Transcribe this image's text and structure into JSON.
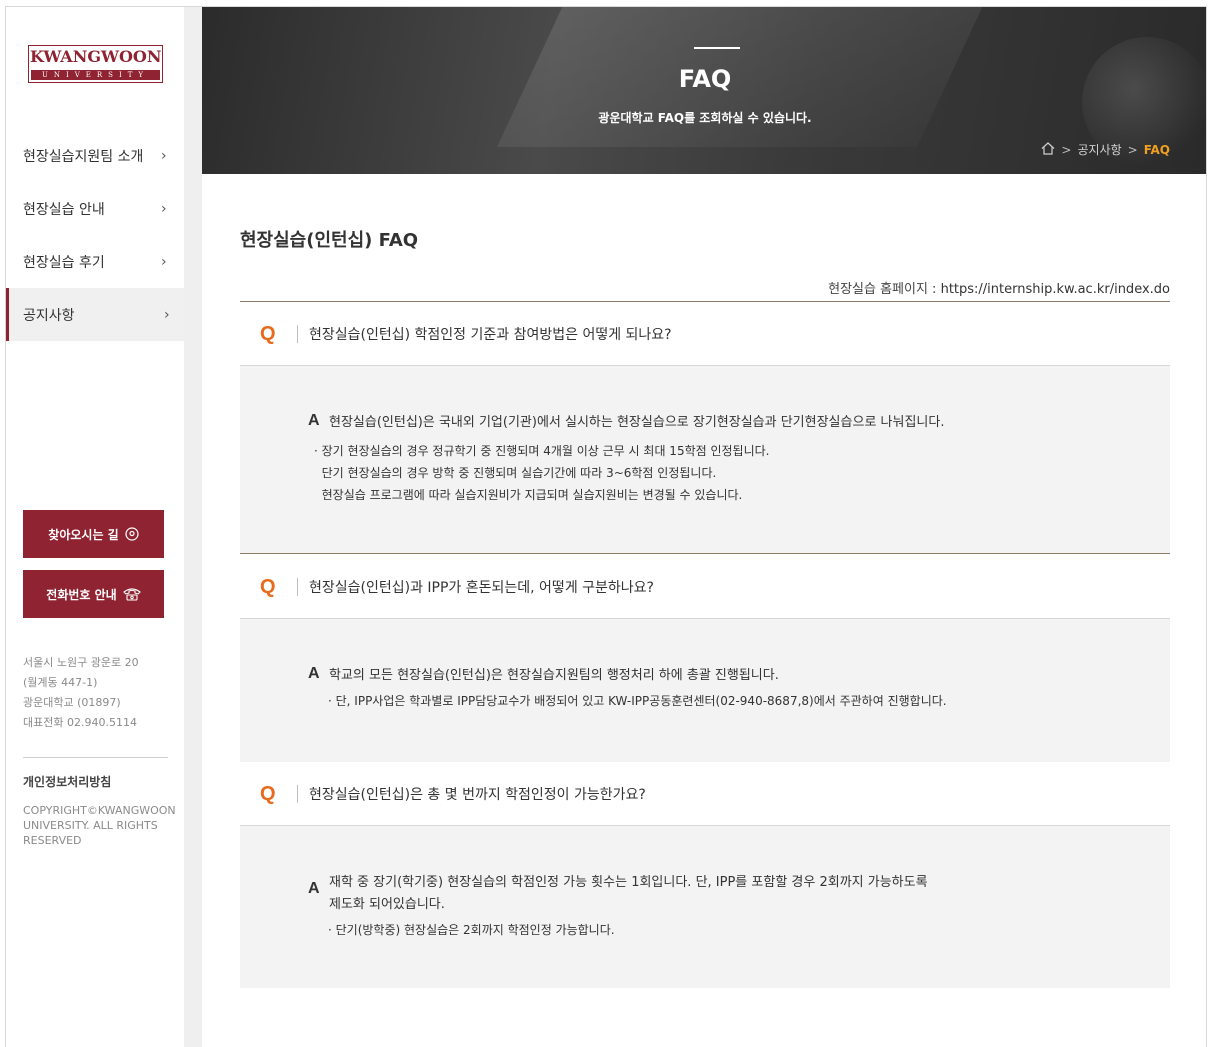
{
  "sidebar": {
    "logo": {
      "main": "KWANGWOON",
      "sub": "UNIVERSITY"
    },
    "nav": [
      {
        "label": "현장실습지원팀 소개",
        "chevron": "›"
      },
      {
        "label": "현장실습 안내",
        "chevron": "›"
      },
      {
        "label": "현장실습 후기",
        "chevron": "›"
      },
      {
        "label": "공지사항",
        "chevron": "›",
        "active": true
      }
    ],
    "buttons": {
      "directions": "찾아오시는 길",
      "phone": "전화번호 안내"
    },
    "address_lines": [
      "서울시 노원구 광운로 20",
      "(월계동 447-1)",
      "광운대학교 (01897)",
      "대표전화 02.940.5114"
    ],
    "privacy": "개인정보처리방침",
    "copyright": "COPYRIGHT©KWANGWOON UNIVERSITY. ALL RIGHTS RESERVED"
  },
  "banner": {
    "title": "FAQ",
    "subtitle": "광운대학교 FAQ를 조회하실 수 있습니다.",
    "breadcrumb": {
      "separator": ">",
      "section": "공지사항",
      "current": "FAQ"
    }
  },
  "main": {
    "title": "현장실습(인턴십) FAQ",
    "homepage_label": "현장실습 홈페이지 :",
    "homepage_url": "https://internship.kw.ac.kr/index.do",
    "faqs": [
      {
        "q_mark": "Q",
        "question": "현장실습(인턴십) 학점인정 기준과 참여방법은 어떻게 되나요?",
        "a_mark": "A",
        "answer": "현장실습(인턴십)은 국내외 기업(기관)에서 실시하는 현장실습으로 장기현장실습과 단기현장실습으로 나눠집니다.",
        "bullets": [
          "· 장기 현장실습의 경우 정규학기 중 진행되며 4개월 이상 근무 시 최대 15학점 인정됩니다.",
          "  단기 현장실습의 경우 방학 중 진행되며 실습기간에 따라 3~6학점 인정됩니다.",
          "  현장실습 프로그램에 따라 실습지원비가 지급되며 실습지원비는 변경될 수 있습니다."
        ]
      },
      {
        "q_mark": "Q",
        "question": "현장실습(인턴십)과 IPP가 혼돈되는데, 어떻게 구분하나요?",
        "a_mark": "A",
        "answer": "학교의 모든 현장실습(인턴십)은 현장실습지원팀의 행정처리 하에 총괄 진행됩니다.",
        "bullets": [
          "· 단, IPP사업은 학과별로 IPP담당교수가 배정되어 있고 KW-IPP공동훈련센터(02-940-8687,8)에서 주관하여 진행합니다."
        ]
      },
      {
        "q_mark": "Q",
        "question": "현장실습(인턴십)은 총 몇 번까지 학점인정이 가능한가요?",
        "a_mark": "A",
        "answer_lines": [
          "재학 중 장기(학기중) 현장실습의 학점인정 가능 횟수는 1회입니다. 단, IPP를 포함할 경우 2회까지 가능하도록",
          "제도화 되어있습니다."
        ],
        "bullets": [
          "· 단기(방학중) 현장실습은 2회까지 학점인정 가능합니다."
        ]
      }
    ]
  },
  "colors": {
    "brand": "#8f2332",
    "q_mark": "#e86a1c",
    "breadcrumb_current": "#f0a020",
    "answer_bg": "#f3f3f3"
  }
}
